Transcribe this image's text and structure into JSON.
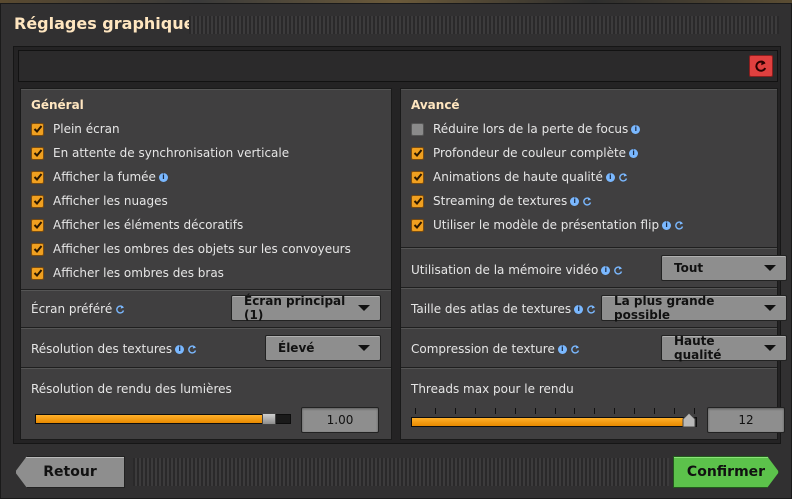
{
  "window": {
    "title": "Réglages graphiques"
  },
  "toolbar": {
    "reset_icon": "reset-icon",
    "reset_color": "#e0403f"
  },
  "general": {
    "title": "Général",
    "checkboxes": [
      {
        "label": "Plein écran",
        "checked": true
      },
      {
        "label": "En attente de synchronisation verticale",
        "checked": true
      },
      {
        "label": "Afficher la fumée",
        "checked": true
      },
      {
        "label": "Afficher les nuages",
        "checked": true
      },
      {
        "label": "Afficher les éléments décoratifs",
        "checked": true
      },
      {
        "label": "Afficher les ombres des objets sur les convoyeurs",
        "checked": true
      },
      {
        "label": "Afficher les ombres des bras",
        "checked": true
      }
    ],
    "preferred_screen": {
      "label": "Écran préféré",
      "value": "Écran principal (1)"
    },
    "texture_resolution": {
      "label": "Résolution des textures",
      "value": "Élevé"
    },
    "light_render": {
      "label": "Résolution de rendu des lumières",
      "value": "1.00",
      "fraction": 0.94
    }
  },
  "advanced": {
    "title": "Avancé",
    "checkboxes": [
      {
        "label": "Réduire lors de la perte de focus",
        "checked": false
      },
      {
        "label": "Profondeur de couleur complète",
        "checked": true
      },
      {
        "label": "Animations de haute qualité",
        "checked": true
      },
      {
        "label": "Streaming de textures",
        "checked": true
      },
      {
        "label": "Utiliser le modèle de présentation flip",
        "checked": true
      }
    ],
    "vram": {
      "label": "Utilisation de la mémoire vidéo",
      "value": "Tout"
    },
    "atlas": {
      "label": "Taille des atlas de textures",
      "value": "La plus grande possible"
    },
    "compression": {
      "label": "Compression de texture",
      "value": "Haute qualité"
    },
    "threads": {
      "label": "Threads max pour le rendu",
      "value": "12",
      "fraction": 1.0
    }
  },
  "footer": {
    "back_label": "Retour",
    "confirm_label": "Confirmer",
    "confirm_color": "#5cc24b"
  },
  "colors": {
    "accent_orange": "#f0a020",
    "title_color": "#ffe6c0",
    "info_blue": "#7ab8ff"
  }
}
